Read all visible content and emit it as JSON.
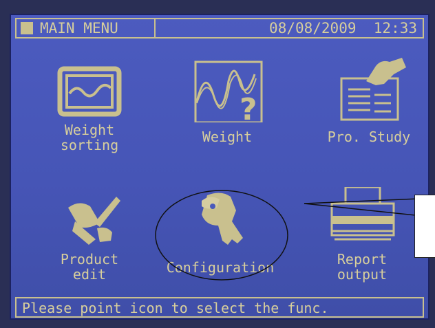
{
  "title_bar": {
    "title": "MAIN MENU",
    "date": "08/08/2009",
    "time": "12:33"
  },
  "menu": [
    {
      "label": "Weight\nsorting",
      "icon": "weight-sorting-icon"
    },
    {
      "label": "Weight",
      "icon": "weight-graph-icon"
    },
    {
      "label": "Pro. Study",
      "icon": "pro-study-icon"
    },
    {
      "label": "Product\nedit",
      "icon": "product-edit-icon"
    },
    {
      "label": "Configuration",
      "icon": "keys-icon"
    },
    {
      "label": "Report\noutput",
      "icon": "printer-icon"
    }
  ],
  "status_bar": {
    "text": "Please point icon to select the func."
  },
  "colors": {
    "screen_bg": "#4a59bb",
    "lcd_text": "#d8cf9c",
    "annotation": "#111111"
  }
}
